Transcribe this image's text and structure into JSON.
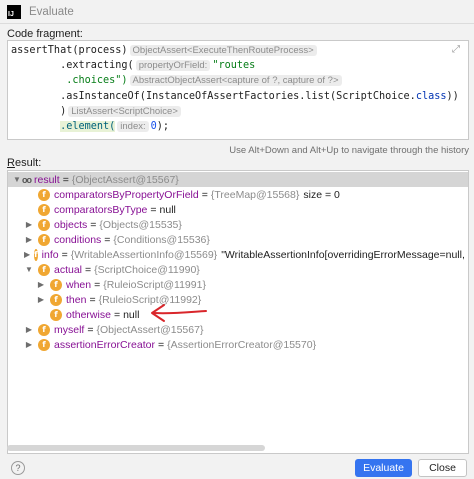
{
  "window": {
    "app_icon": "IJ",
    "title": "Evaluate"
  },
  "fragment": {
    "label": "Code fragment:",
    "lines": [
      {
        "code_a": "assertThat(process)",
        "hint": "ObjectAssert<ExecuteThenRouteProcess>"
      },
      {
        "code_a": ".extracting(",
        "hint": "propertyOrField:",
        "str": "\"routes"
      },
      {
        "str": ".choices\")",
        "hint": "AbstractObjectAssert<capture of ?, capture of ?>"
      },
      {
        "code_a": ".asInstanceOf(InstanceOfAssertFactories.list(ScriptChoice.",
        "kw": "class",
        "code_b": "))"
      },
      {
        "code_a": ")",
        "hint": "ListAssert<ScriptChoice>"
      },
      {
        "ident": ".element(",
        "hint": "index:",
        "num": "0",
        "code_b": ");"
      }
    ],
    "expand_icon": "expand-icon"
  },
  "nav_hint": "Use Alt+Down and Alt+Up to navigate through the history",
  "result": {
    "label_u": "R",
    "label_rest": "esult:",
    "rows": [
      {
        "name": "result",
        "eq": "=",
        "ref": "{ObjectAssert@15567}",
        "text": ""
      },
      {
        "name": "comparatorsByPropertyOrField",
        "eq": "=",
        "ref": "{TreeMap@15568}",
        "text": "size = 0"
      },
      {
        "name": "comparatorsByType",
        "eq": "=",
        "ref": "",
        "text": "null"
      },
      {
        "name": "objects",
        "eq": "=",
        "ref": "{Objects@15535}",
        "text": ""
      },
      {
        "name": "conditions",
        "eq": "=",
        "ref": "{Conditions@15536}",
        "text": ""
      },
      {
        "name": "info",
        "eq": "=",
        "ref": "{WritableAssertionInfo@15569}",
        "text": "\"WritableAssertionInfo[overridingErrorMessage=null, descript"
      },
      {
        "name": "actual",
        "eq": "=",
        "ref": "{ScriptChoice@11990}",
        "text": ""
      },
      {
        "name": "when",
        "eq": "=",
        "ref": "{RuleioScript@11991}",
        "text": ""
      },
      {
        "name": "then",
        "eq": "=",
        "ref": "{RuleioScript@11992}",
        "text": ""
      },
      {
        "name": "otherwise",
        "eq": "=",
        "ref": "",
        "text": "null"
      },
      {
        "name": "myself",
        "eq": "=",
        "ref": "{ObjectAssert@15567}",
        "text": ""
      },
      {
        "name": "assertionErrorCreator",
        "eq": "=",
        "ref": "{AssertionErrorCreator@15570}",
        "text": ""
      }
    ]
  },
  "icons": {
    "field": "f",
    "object": "oo",
    "help": "?"
  },
  "colors": {
    "accent": "#3574f0",
    "field_icon": "#f0a732",
    "annotation_arrow": "#d9262b",
    "field_name": "#871094"
  },
  "buttons": {
    "evaluate": "Evaluate",
    "close": "Close"
  }
}
